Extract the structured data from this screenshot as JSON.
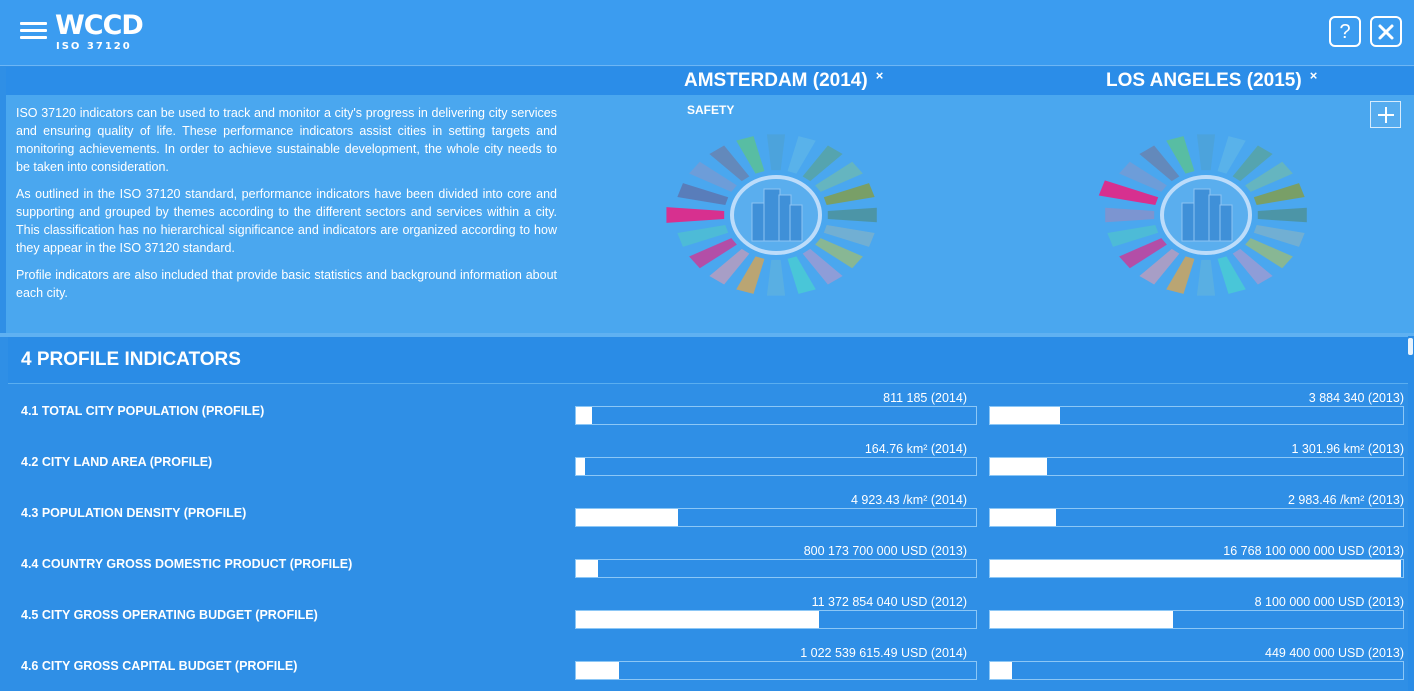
{
  "header": {
    "logo_main": "WCCD",
    "logo_sub": "ISO 37120",
    "help_label": "?"
  },
  "cities": [
    {
      "title": "AMSTERDAM (2014)",
      "remove": "×"
    },
    {
      "title": "LOS ANGELES (2015)",
      "remove": "×"
    }
  ],
  "intro": {
    "paragraphs": [
      "ISO 37120 indicators can be used to track and monitor a city's progress in delivering city services and ensuring quality of life. These performance indicators assist cities in setting targets and monitoring achievements. In order to achieve sustainable development, the whole city needs to be taken into consideration.",
      "As outlined in the ISO 37120 standard, performance indicators have been divided into core and supporting and grouped by themes according to the different sectors and services within a city. This classification has no hierarchical significance and indicators are organized according to how they appear in the ISO 37120 standard.",
      "Profile indicators are also included that provide basic statistics and background information about each city."
    ],
    "theme_label": "SAFETY"
  },
  "wheel": {
    "segment_colors": [
      "#8e8fc7",
      "#5f6fa8",
      "#7a9ad1",
      "#6c7fa9",
      "#5ec48a",
      "#4ea2d6",
      "#5fb6e8",
      "#5aa39a",
      "#6fb9b0",
      "#8a9c3a",
      "#4e8f8f",
      "#7fb2c9",
      "#9dbc76",
      "#a59ad0",
      "#4ad0d0",
      "#5fb1df",
      "#e0a44a",
      "#c79bb8",
      "#d7308f",
      "#4fc2cf"
    ],
    "highlight_color": "#d7308f",
    "city_icon": "city-skyline-icon"
  },
  "section": {
    "title": "4 PROFILE INDICATORS"
  },
  "indicators": [
    {
      "label": "4.1 TOTAL CITY POPULATION (PROFILE)",
      "values": [
        "811 185 (2014)",
        "3 884 340 (2013)"
      ],
      "fractions": [
        0.041,
        0.17
      ]
    },
    {
      "label": "4.2 CITY LAND AREA (PROFILE)",
      "values": [
        "164.76 km² (2014)",
        "1 301.96 km² (2013)"
      ],
      "fractions": [
        0.022,
        0.137
      ]
    },
    {
      "label": "4.3 POPULATION DENSITY (PROFILE)",
      "values": [
        "4 923.43 /km² (2014)",
        "2 983.46 /km² (2013)"
      ],
      "fractions": [
        0.256,
        0.161
      ]
    },
    {
      "label": "4.4 COUNTRY GROSS DOMESTIC PRODUCT (PROFILE)",
      "values": [
        "800 173 700 000 USD (2013)",
        "16 768 100 000 000 USD (2013)"
      ],
      "fractions": [
        0.056,
        0.995
      ]
    },
    {
      "label": "4.5 CITY GROSS OPERATING BUDGET (PROFILE)",
      "values": [
        "11 372 854 040 USD (2012)",
        "8 100 000 000 USD (2013)"
      ],
      "fractions": [
        0.607,
        0.442
      ]
    },
    {
      "label": "4.6 CITY GROSS CAPITAL BUDGET (PROFILE)",
      "values": [
        "1 022 539 615.49 USD (2014)",
        "449 400 000 USD (2013)"
      ],
      "fractions": [
        0.107,
        0.054
      ]
    }
  ]
}
